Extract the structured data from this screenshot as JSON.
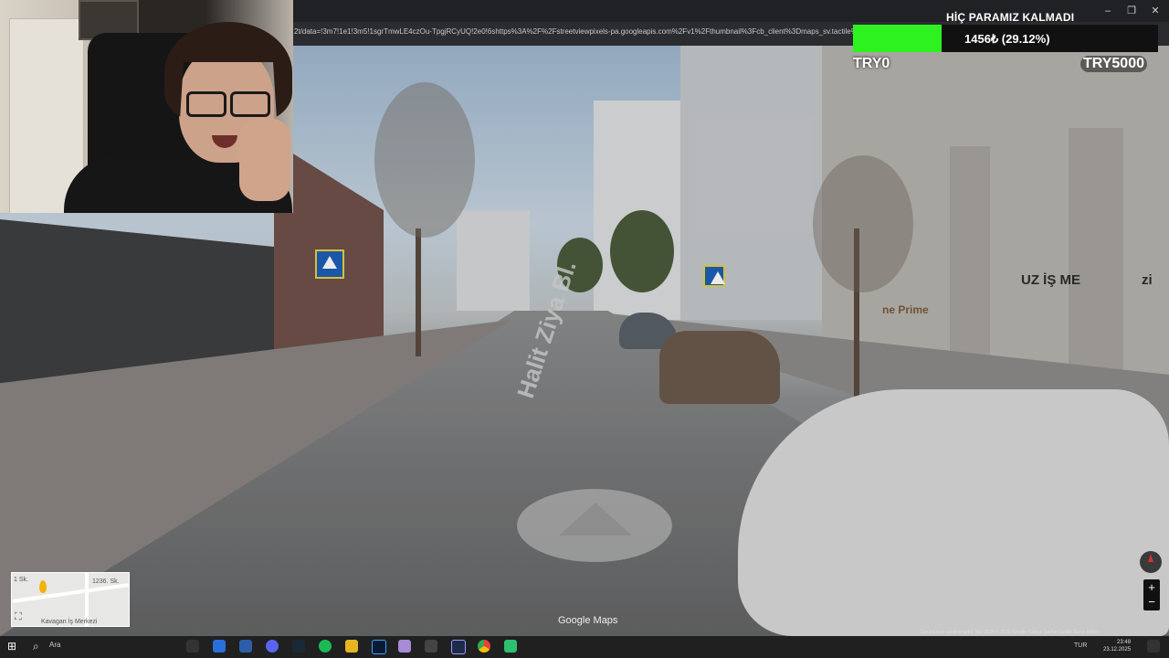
{
  "browser": {
    "url": "2t/data=!3m7!1e1!3m5!1sgrTmwLE4czOu-TpgjRCyUQ!2e0!6shttps%3A%2F%2Fstreetviewpixels-pa.googleapis.com%2Fv1%2Fthumbnail%3Fcb_client%3Dmaps_sv.tactile%26w%3D",
    "minimize": "–",
    "restore": "❐",
    "close": "✕"
  },
  "hud": {
    "title": "HİÇ PARAMIZ KALMADI",
    "amount": "1456₺ (29.12%)",
    "progress": 0.2912,
    "min_label": "TRY0",
    "max_label": "TRY5000",
    "fill_color": "#2ef21f"
  },
  "streetview": {
    "road_label": "Halit Ziya Bl.",
    "sign_uz": "UZ İŞ ME",
    "sign_prime": "ne Prime",
    "sign_zi": "zi",
    "google_maps": "Google Maps",
    "footer": "Görüntünün çekilme tarihi: Mar 2024   © 2025 Google   Türkiye   Şartlar   Gizlilik   Sorun bildirin",
    "zoom_in": "+",
    "zoom_out": "−"
  },
  "minimap": {
    "label": "Kavagan İş Merkezi",
    "street1": "1 Sk.",
    "street2": "1236. Sk.",
    "expand": "⛶"
  },
  "taskbar": {
    "start": "⊞",
    "search_icon": "⌕",
    "search": "Ara",
    "tray_lang": "TUR",
    "time": "23:48",
    "date": "23.12.2025"
  },
  "icons": {
    "compass": "compass-icon",
    "expand": "expand-icon"
  }
}
